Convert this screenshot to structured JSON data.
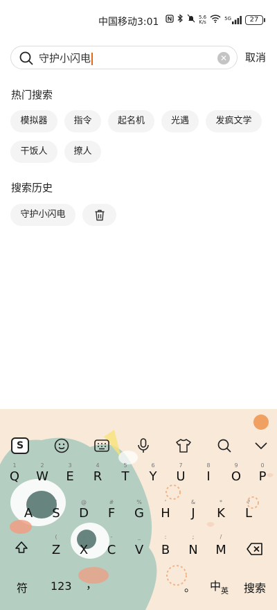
{
  "status": {
    "carrier": "中国移动",
    "time": "3:01",
    "network": "5G",
    "speed_top": "5.6",
    "speed_bottom": "K/s",
    "battery": "27"
  },
  "search": {
    "query": "守护小闪电",
    "cancel_label": "取消"
  },
  "hot": {
    "title": "热门搜索",
    "chips": [
      "模拟器",
      "指令",
      "起名机",
      "光遇",
      "发疯文学",
      "干饭人",
      "撩人"
    ]
  },
  "history": {
    "title": "搜索历史",
    "items": [
      "守护小闪电"
    ]
  },
  "keyboard": {
    "row1": [
      "Q",
      "W",
      "E",
      "R",
      "T",
      "Y",
      "U",
      "I",
      "O",
      "P"
    ],
    "row1_hints": [
      "1",
      "2",
      "3",
      "4",
      "5",
      "6",
      "7",
      "8",
      "9",
      "0"
    ],
    "row2": [
      "A",
      "S",
      "D",
      "F",
      "G",
      "H",
      "J",
      "K",
      "L"
    ],
    "row2_hints": [
      "~",
      "!",
      "@",
      "#",
      "%",
      "'",
      "&",
      "*",
      "?"
    ],
    "row3": [
      "Z",
      "X",
      "C",
      "V",
      "B",
      "N",
      "M"
    ],
    "row3_hints": [
      "(",
      ")",
      "-",
      "_",
      ":",
      ";",
      "/"
    ],
    "symbol_label": "符",
    "num_label": "123",
    "comma": "，",
    "period": "。",
    "lang_main": "中",
    "lang_sub": "英",
    "search_label": "搜索",
    "brand_key": "S",
    "accent": "#f8e9d8"
  }
}
